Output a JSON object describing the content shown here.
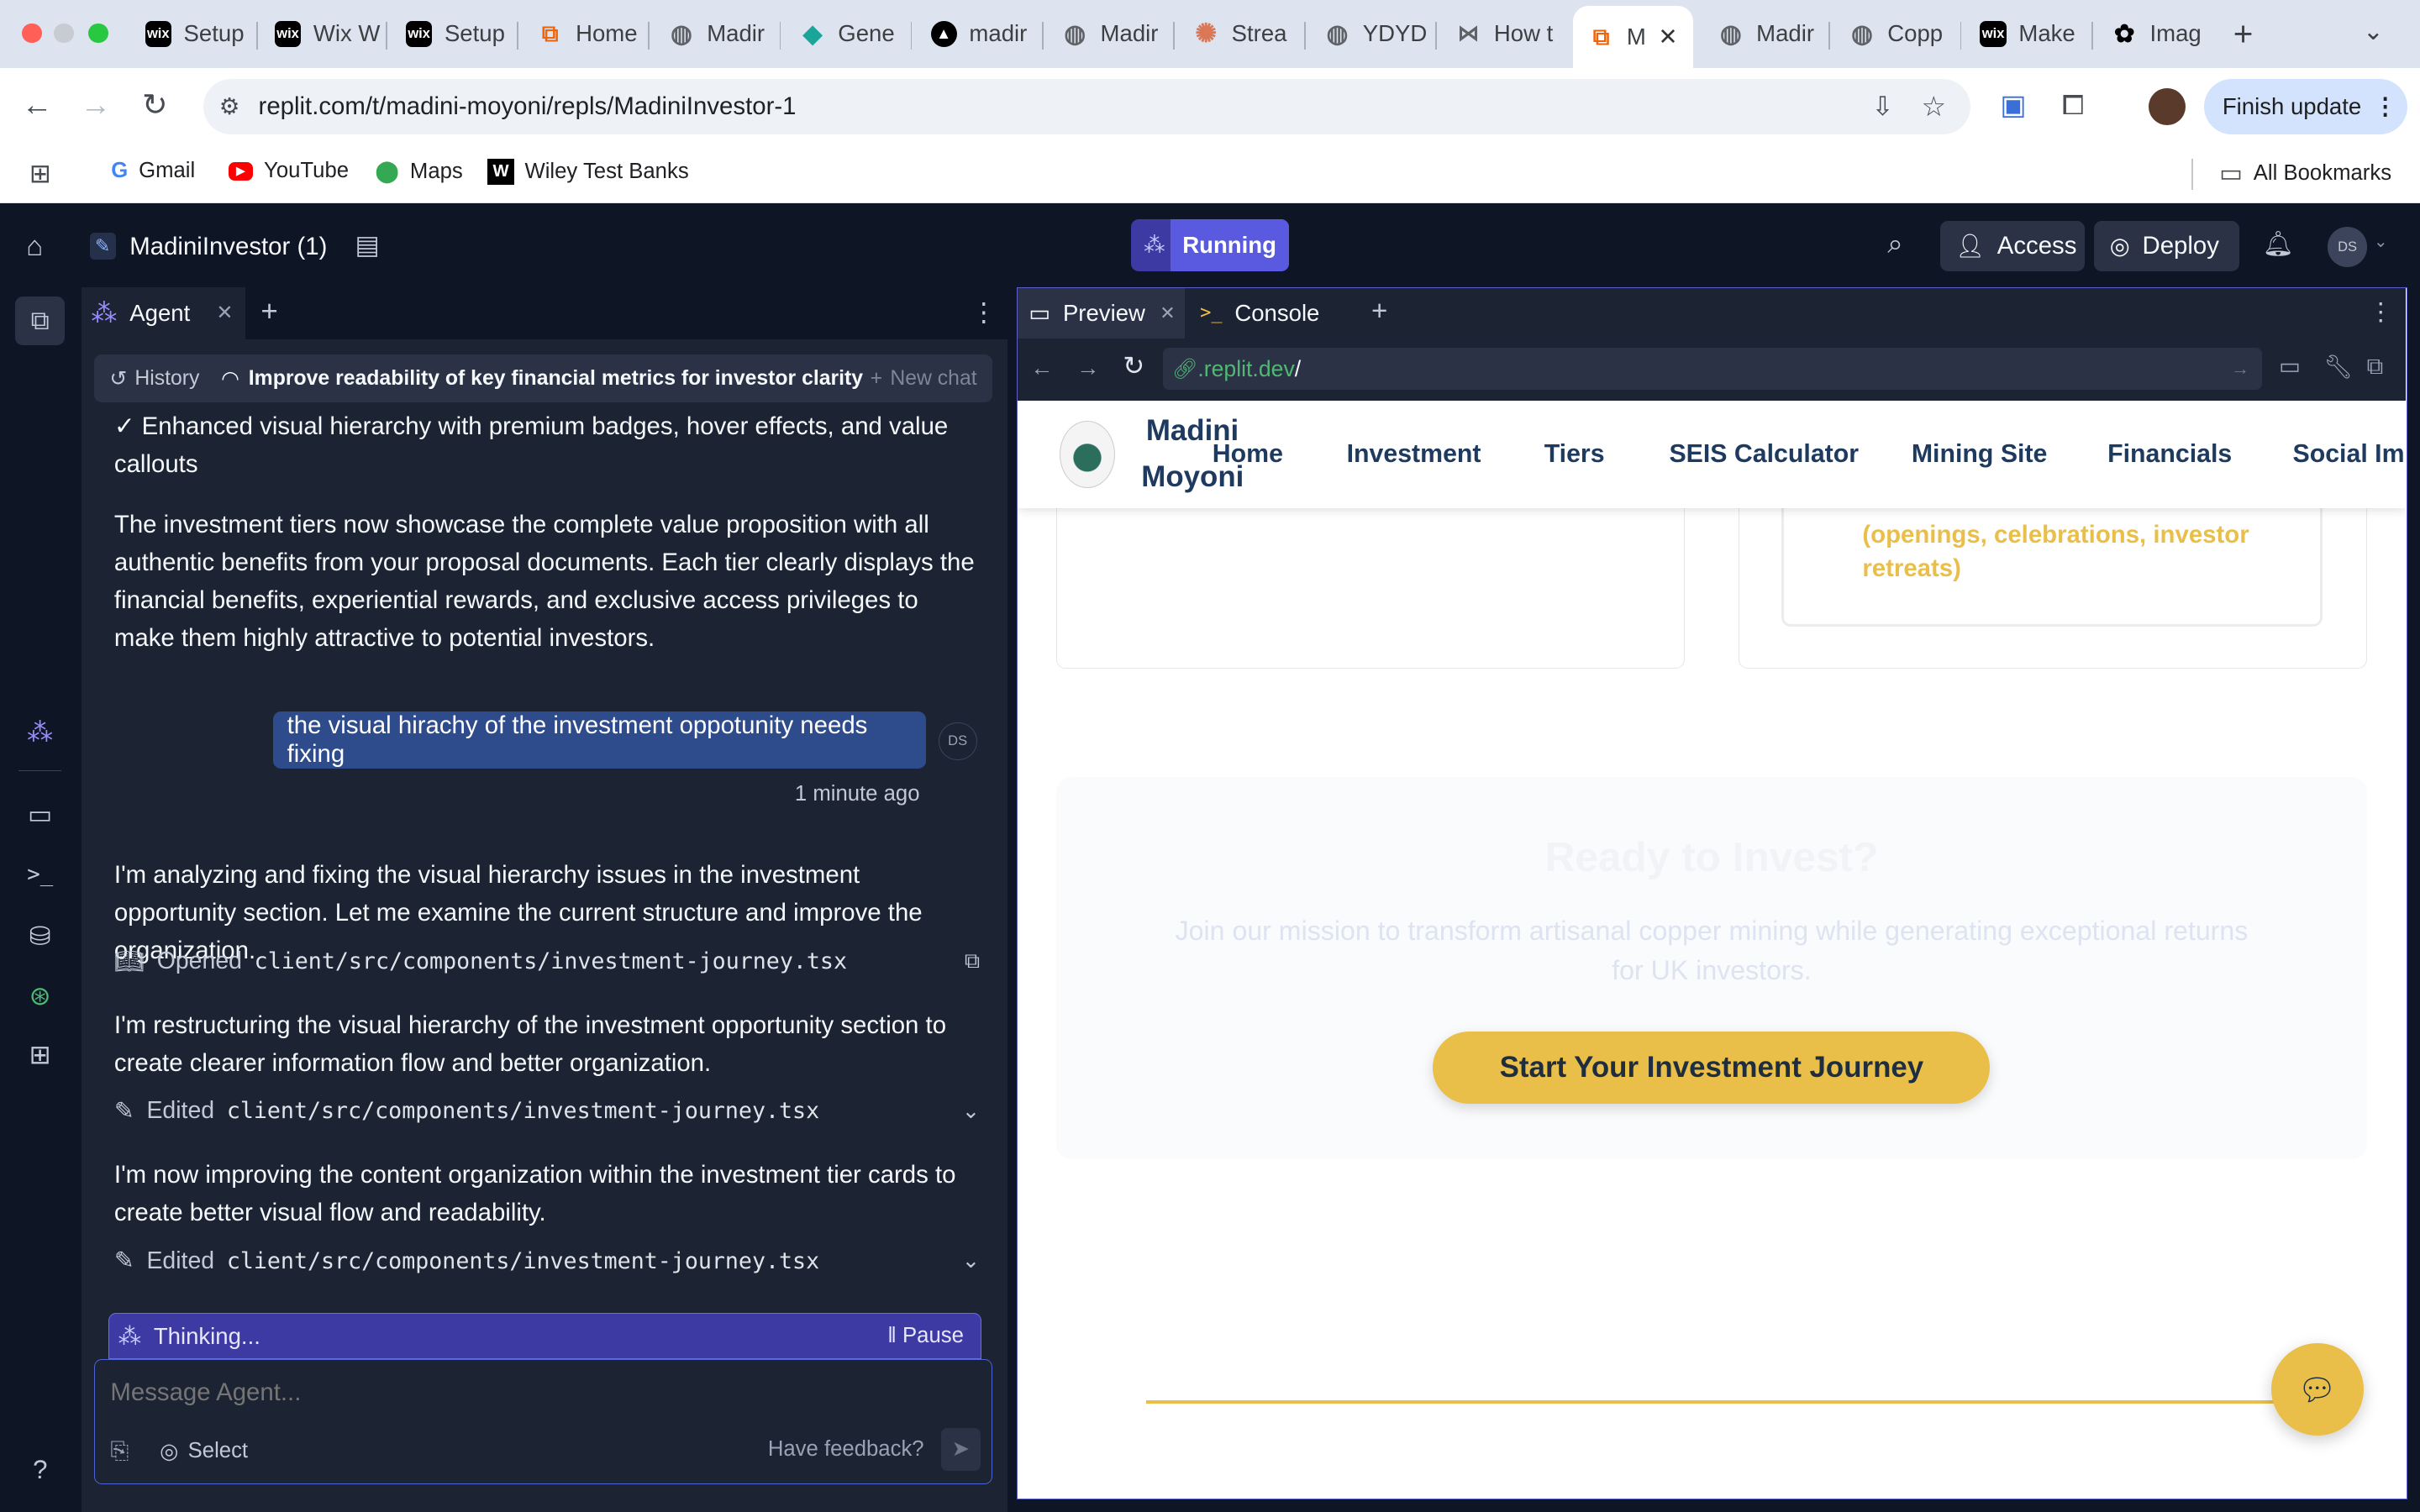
{
  "browser": {
    "tabs": [
      {
        "label": "Setup",
        "icon": "wix-icon"
      },
      {
        "label": "Wix W",
        "icon": "wix-icon"
      },
      {
        "label": "Setup",
        "icon": "wix-icon"
      },
      {
        "label": "Home",
        "icon": "replit-icon"
      },
      {
        "label": "Madir",
        "icon": "globe-icon"
      },
      {
        "label": "Gene",
        "icon": "diamond-icon"
      },
      {
        "label": "madir",
        "icon": "drive-icon"
      },
      {
        "label": "Madir",
        "icon": "globe-icon"
      },
      {
        "label": "Strea",
        "icon": "claude-icon"
      },
      {
        "label": "YDYD",
        "icon": "globe-icon"
      },
      {
        "label": "How t",
        "icon": "grid-icon"
      },
      {
        "label": "M",
        "icon": "replit-icon"
      },
      {
        "label": "Madir",
        "icon": "globe-icon"
      },
      {
        "label": "Copp",
        "icon": "globe-icon"
      },
      {
        "label": "Make",
        "icon": "wix-icon"
      },
      {
        "label": "Imag",
        "icon": "openai-icon"
      }
    ],
    "url": "replit.com/t/madini-moyoni/repls/MadiniInvestor-1",
    "finish_update": "Finish update",
    "bookmarks": [
      "Gmail",
      "YouTube",
      "Maps",
      "Wiley Test Banks"
    ],
    "all_bookmarks": "All Bookmarks"
  },
  "replit": {
    "project_name": "MadiniInvestor (1)",
    "running": "Running",
    "access": "Access",
    "deploy": "Deploy",
    "avatar": "DS"
  },
  "agent": {
    "tab_label": "Agent",
    "history": "History",
    "chat_title": "Improve readability of key financial metrics for investor clarity",
    "new_chat": "New chat",
    "messages": {
      "m1": "✓ Enhanced visual hierarchy with premium badges, hover effects, and value callouts",
      "m2": "The investment tiers now showcase the complete value proposition with all authentic benefits from your proposal documents. Each tier clearly displays the financial benefits, experiential rewards, and exclusive access privileges to make them highly attractive to potential investors.",
      "user": "the visual hirachy of the investment oppotunity needs fixing",
      "user_avatar": "DS",
      "user_time": "1 minute ago",
      "m3": "I'm analyzing and fixing the visual hierarchy issues in the investment opportunity section. Let me examine the current structure and improve the organization.",
      "f1_action": "Opened",
      "f1_path": "client/src/components/investment-journey.tsx",
      "m4": "I'm restructuring the visual hierarchy of the investment opportunity section to create clearer information flow and better organization.",
      "f2_action": "Edited",
      "f2_path": "client/src/components/investment-journey.tsx",
      "m5": "I'm now improving the content organization within the investment tier cards to create better visual flow and readability.",
      "f3_action": "Edited",
      "f3_path": "client/src/components/investment-journey.tsx"
    },
    "thinking": "Thinking...",
    "pause": "Pause",
    "input_placeholder": "Message Agent...",
    "select": "Select",
    "feedback": "Have feedback?"
  },
  "preview": {
    "tab_preview": "Preview",
    "tab_console": "Console",
    "url_host": ".replit.dev",
    "url_path": "/",
    "site": {
      "brand_line1": "Madini",
      "brand_line2": "Moyoni",
      "nav": [
        "Home",
        "Investment",
        "Tiers",
        "SEIS Calculator",
        "Mining Site",
        "Financials",
        "Social Imp"
      ],
      "card_text": "(openings, celebrations, investor retreats)",
      "cta_title": "Ready to Invest?",
      "cta_text": "Join our mission to transform artisanal copper mining while generating exceptional returns for UK investors.",
      "cta_button": "Start Your Investment Journey"
    }
  },
  "colors": {
    "accent": "#5b5fc7",
    "gold": "#e9bf4a",
    "navy": "#1e3a5f",
    "running": "#4f4fd6"
  }
}
